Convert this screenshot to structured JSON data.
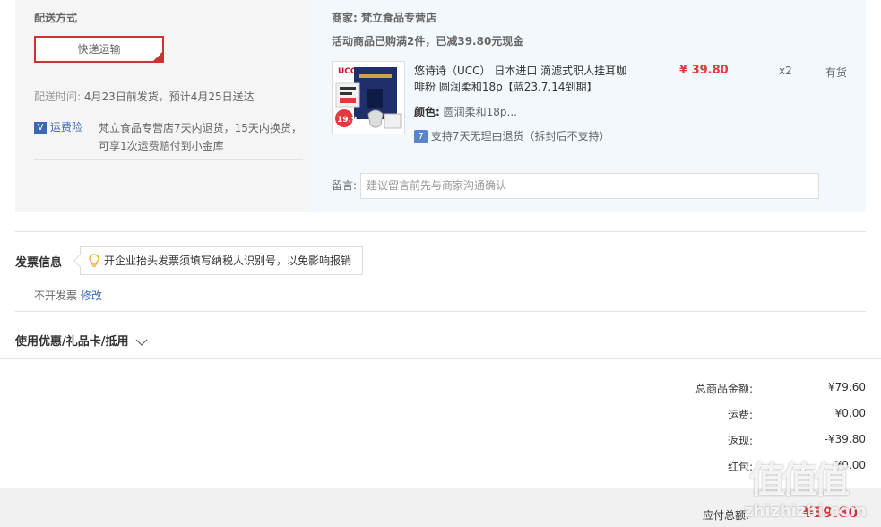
{
  "shipping": {
    "title": "配送方式",
    "method_button": "快递运输",
    "time_label": "配送时间:",
    "time_value": "4月23日前发货，预计4月25日送达",
    "insurance_label": "运费险",
    "insurance_badge": "V",
    "insurance_desc_1": "梵立食品专营店7天内退货，15天内换货，",
    "insurance_desc_2": "可享1次运费赔付到小金库"
  },
  "merchant": {
    "label": "商家:",
    "name": "梵立食品专营店",
    "promo": "活动商品已购满2件，已减39.80元现金"
  },
  "product": {
    "image_brand": "UCC",
    "image_badge": "19.9",
    "title_line1": "悠诗诗（UCC） 日本进口 滴滤式职人挂耳咖",
    "title_line2": "啡粉 圆润柔和18p【蓝23.7.14到期】",
    "price": "¥ 39.80",
    "quantity": "x2",
    "stock": "有货",
    "color_label": "颜色:",
    "color_value": "圆润柔和18p...",
    "return_badge": "7",
    "return_policy": "支持7天无理由退货（拆封后不支持）"
  },
  "comment": {
    "label": "留言:",
    "placeholder": "建议留言前先与商家沟通确认"
  },
  "invoice": {
    "title": "发票信息",
    "tip": "开企业抬头发票须填写纳税人识别号，以免影响报销",
    "status": "不开发票",
    "edit": "修改"
  },
  "discount": {
    "label": "使用优惠/礼品卡/抵用"
  },
  "summary": {
    "total_label": "总商品金额:",
    "total_value": "¥79.60",
    "shipping_label": "运费:",
    "shipping_value": "¥0.00",
    "cashback_label": "返现:",
    "cashback_value": "-¥39.80",
    "redpacket_label": "红包:",
    "redpacket_value": "-¥0.00",
    "payable_label": "应付总额:",
    "payable_value": "¥39.80"
  },
  "watermark": {
    "logo": "值值值",
    "domain": "zhizhizhi.com"
  },
  "colors": {
    "accent_red": "#e4393c",
    "link_blue": "#3a68b6",
    "panel_gray": "#f5f5f5",
    "panel_blue": "#f3f8fc"
  }
}
